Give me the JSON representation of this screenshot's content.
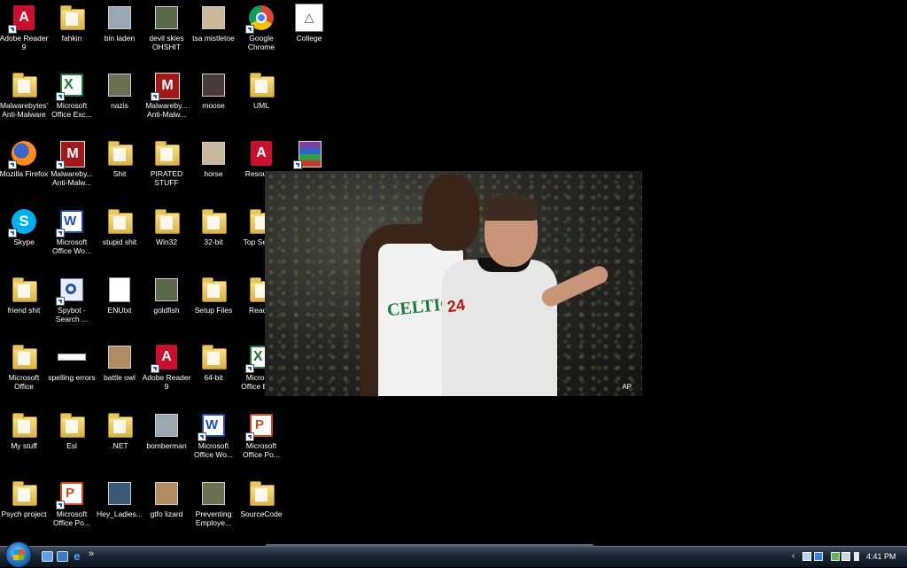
{
  "desktop": {
    "icons": [
      {
        "label": "Adobe Reader 9",
        "icon": "acrobat-icon",
        "shortcut": true
      },
      {
        "label": "fahkin",
        "icon": "folder-icon",
        "shortcut": false
      },
      {
        "label": "bin laden",
        "icon": "image-icon",
        "shortcut": false
      },
      {
        "label": "devil skies OHSHIT",
        "icon": "image-icon",
        "shortcut": false
      },
      {
        "label": "tsa mistletoe",
        "icon": "image-icon",
        "shortcut": false
      },
      {
        "label": "Google Chrome",
        "icon": "chrome-icon",
        "shortcut": true
      },
      {
        "label": "College",
        "icon": "college-icon",
        "shortcut": false
      },
      {
        "label": "Malwarebytes' Anti-Malware",
        "icon": "folder-icon",
        "shortcut": false
      },
      {
        "label": "Microsoft Office Exc...",
        "icon": "excel-icon",
        "shortcut": true
      },
      {
        "label": "nazis",
        "icon": "image-icon",
        "shortcut": false
      },
      {
        "label": "Malwareby... Anti-Malw...",
        "icon": "malwarebytes-icon",
        "shortcut": true
      },
      {
        "label": "moose",
        "icon": "image-icon",
        "shortcut": false
      },
      {
        "label": "UML",
        "icon": "folder-icon",
        "shortcut": false
      },
      {
        "label": "Mozilla Firefox",
        "icon": "firefox-icon",
        "shortcut": true
      },
      {
        "label": "Malwareby... Anti-Malw...",
        "icon": "malwarebytes-icon",
        "shortcut": true
      },
      {
        "label": "Shit",
        "icon": "folder-icon",
        "shortcut": false
      },
      {
        "label": "PIRATED STUFF",
        "icon": "folder-icon",
        "shortcut": false
      },
      {
        "label": "horse",
        "icon": "image-icon",
        "shortcut": false
      },
      {
        "label": "Resource",
        "icon": "pdf-icon",
        "shortcut": false
      },
      {
        "label": "WinRAR",
        "icon": "winrar-icon",
        "shortcut": true
      },
      {
        "label": "Skype",
        "icon": "skype-icon",
        "shortcut": true
      },
      {
        "label": "Microsoft Office Wo...",
        "icon": "word-icon",
        "shortcut": true
      },
      {
        "label": "stupid shit",
        "icon": "folder-icon",
        "shortcut": false
      },
      {
        "label": "Win32",
        "icon": "folder-icon",
        "shortcut": false
      },
      {
        "label": "32-bit",
        "icon": "folder-icon",
        "shortcut": false
      },
      {
        "label": "Top Secret",
        "icon": "folder-icon",
        "shortcut": false
      },
      {
        "label": "friend shit",
        "icon": "folder-icon",
        "shortcut": false
      },
      {
        "label": "Spybot - Search ...",
        "icon": "spybot-icon",
        "shortcut": true
      },
      {
        "label": "ENUtxt",
        "icon": "pdf-document-icon",
        "shortcut": false
      },
      {
        "label": "goldfish",
        "icon": "image-icon",
        "shortcut": false
      },
      {
        "label": "Setup Files",
        "icon": "folder-icon",
        "shortcut": false
      },
      {
        "label": "Reader",
        "icon": "folder-icon",
        "shortcut": false
      },
      {
        "label": "Microsoft Office",
        "icon": "folder-icon",
        "shortcut": false
      },
      {
        "label": "spelling errors",
        "icon": "text-file-icon",
        "shortcut": false
      },
      {
        "label": "battle owl",
        "icon": "image-icon",
        "shortcut": false
      },
      {
        "label": "Adobe Reader 9",
        "icon": "acrobat-icon",
        "shortcut": true
      },
      {
        "label": "64-bit",
        "icon": "folder-icon",
        "shortcut": false
      },
      {
        "label": "Microsoft Office Exc...",
        "icon": "excel-icon",
        "shortcut": true
      },
      {
        "label": "My stuff",
        "icon": "folder-icon",
        "shortcut": false
      },
      {
        "label": "Esl",
        "icon": "folder-icon",
        "shortcut": false
      },
      {
        "label": ".NET",
        "icon": "folder-icon",
        "shortcut": false
      },
      {
        "label": "bomberman",
        "icon": "image-icon",
        "shortcut": false
      },
      {
        "label": "Microsoft Office Wo...",
        "icon": "word-icon",
        "shortcut": true
      },
      {
        "label": "Microsoft Office Po...",
        "icon": "powerpoint-icon",
        "shortcut": true
      },
      {
        "label": "Psych project",
        "icon": "folder-icon",
        "shortcut": false
      },
      {
        "label": "Microsoft Office Po...",
        "icon": "powerpoint-icon",
        "shortcut": true
      },
      {
        "label": "Hey_Ladies...",
        "icon": "image-icon",
        "shortcut": false
      },
      {
        "label": "gtfo lizard",
        "icon": "image-icon",
        "shortcut": false
      },
      {
        "label": "Preventing Employe...",
        "icon": "image-icon",
        "shortcut": false
      },
      {
        "label": "SourceCode",
        "icon": "folder-icon",
        "shortcut": false
      }
    ]
  },
  "wallpaper": {
    "jersey_text": "CELTICS",
    "ref_number": "24",
    "credit": "AP"
  },
  "taskbar": {
    "quick_launch": [
      "show-desktop-icon",
      "switch-windows-icon",
      "internet-explorer-icon"
    ],
    "more_label": "»",
    "tray": {
      "expand_label": "‹",
      "clock": "4:41 PM"
    }
  },
  "colors": {
    "desktop_bg": "#000000",
    "taskbar_top": "#3b4a5c",
    "taskbar_bottom": "#0d141d",
    "icon_label": "#ffffff"
  }
}
